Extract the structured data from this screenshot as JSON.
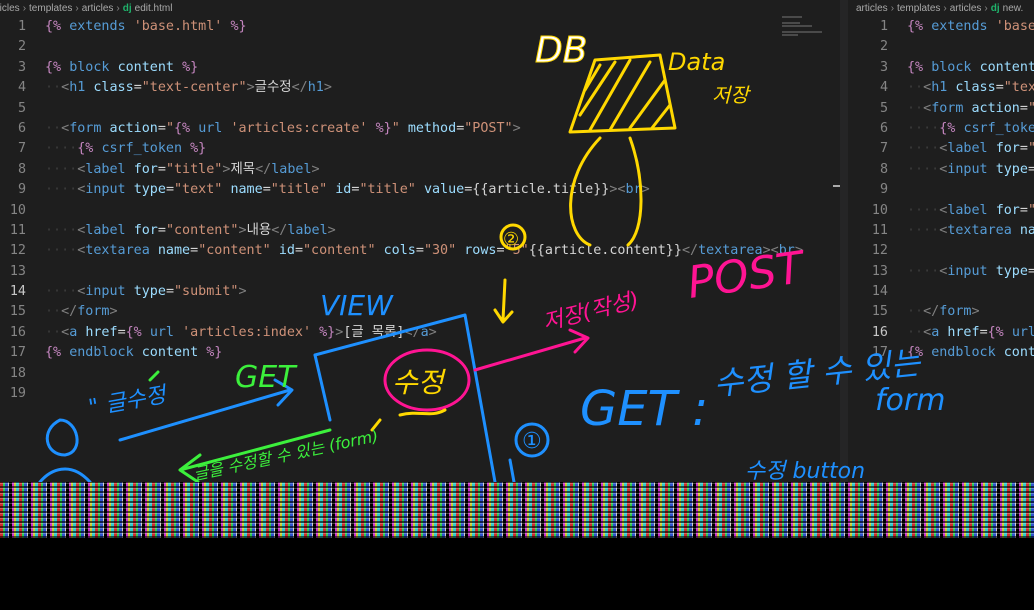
{
  "left_pane": {
    "breadcrumbs": [
      "articles",
      "templates",
      "articles"
    ],
    "file_badge": "dj",
    "file_name": "edit.html",
    "active_line": 14,
    "lines": [
      {
        "n": "1",
        "html": "<span class='tmpl'>{%</span> <span class='kw'>extends</span> <span class='str'>'base.html'</span> <span class='tmpl'>%}</span>"
      },
      {
        "n": "2",
        "html": ""
      },
      {
        "n": "3",
        "html": "<span class='tmpl'>{%</span> <span class='kw'>block</span> <span class='var'>content</span> <span class='tmpl'>%}</span>"
      },
      {
        "n": "4",
        "html": "<span class='ws'>··</span><span class='pun'>&lt;</span><span class='tag'>h1</span> <span class='attr'>class</span><span class='txt'>=</span><span class='str'>\"text-center\"</span><span class='pun'>&gt;</span><span class='txt'>글수정</span><span class='pun'>&lt;/</span><span class='tag'>h1</span><span class='pun'>&gt;</span>"
      },
      {
        "n": "5",
        "html": ""
      },
      {
        "n": "6",
        "html": "<span class='ws'>··</span><span class='pun'>&lt;</span><span class='tag'>form</span> <span class='attr'>action</span><span class='txt'>=</span><span class='str'>\"</span><span class='tmpl'>{%</span> <span class='kw'>url</span> <span class='str'>'articles:create'</span> <span class='tmpl'>%}</span><span class='str'>\"</span> <span class='attr'>method</span><span class='txt'>=</span><span class='str'>\"POST\"</span><span class='pun'>&gt;</span>"
      },
      {
        "n": "7",
        "html": "<span class='ws'>····</span><span class='tmpl'>{%</span> <span class='kw'>csrf_token</span> <span class='tmpl'>%}</span>"
      },
      {
        "n": "8",
        "html": "<span class='ws'>····</span><span class='pun'>&lt;</span><span class='tag'>label</span> <span class='attr'>for</span><span class='txt'>=</span><span class='str'>\"title\"</span><span class='pun'>&gt;</span><span class='txt'>제목</span><span class='pun'>&lt;/</span><span class='tag'>label</span><span class='pun'>&gt;</span>"
      },
      {
        "n": "9",
        "html": "<span class='ws'>····</span><span class='pun'>&lt;</span><span class='tag'>input</span> <span class='attr'>type</span><span class='txt'>=</span><span class='str'>\"text\"</span> <span class='attr'>name</span><span class='txt'>=</span><span class='str'>\"title\"</span> <span class='attr'>id</span><span class='txt'>=</span><span class='str'>\"title\"</span> <span class='attr'>value</span><span class='txt'>={{article.title}}</span><span class='pun'>&gt;&lt;</span><span class='tag'>br</span><span class='pun'>&gt;</span>"
      },
      {
        "n": "10",
        "html": ""
      },
      {
        "n": "11",
        "html": "<span class='ws'>····</span><span class='pun'>&lt;</span><span class='tag'>label</span> <span class='attr'>for</span><span class='txt'>=</span><span class='str'>\"content\"</span><span class='pun'>&gt;</span><span class='txt'>내용</span><span class='pun'>&lt;/</span><span class='tag'>label</span><span class='pun'>&gt;</span>"
      },
      {
        "n": "12",
        "html": "<span class='ws'>····</span><span class='pun'>&lt;</span><span class='tag'>textarea</span> <span class='attr'>name</span><span class='txt'>=</span><span class='str'>\"content\"</span> <span class='attr'>id</span><span class='txt'>=</span><span class='str'>\"content\"</span> <span class='attr'>cols</span><span class='txt'>=</span><span class='str'>\"30\"</span> <span class='attr'>rows</span><span class='txt'>=</span><span class='str'>\"5\"</span><span class='txt'>{{article.content}}</span><span class='pun'>&lt;/</span><span class='tag'>textarea</span><span class='pun'>&gt;&lt;</span><span class='tag'>br</span><span class='pun'>&gt;</span>"
      },
      {
        "n": "13",
        "html": ""
      },
      {
        "n": "14",
        "html": "<span class='ws'>····</span><span class='pun'>&lt;</span><span class='tag'>input</span> <span class='attr'>type</span><span class='txt'>=</span><span class='str'>\"submit\"</span><span class='pun'>&gt;</span>"
      },
      {
        "n": "15",
        "html": "<span class='ws'>··</span><span class='pun'>&lt;/</span><span class='tag'>form</span><span class='pun'>&gt;</span>"
      },
      {
        "n": "16",
        "html": "<span class='ws'>··</span><span class='pun'>&lt;</span><span class='tag'>a</span> <span class='attr'>href</span><span class='txt'>=</span><span class='tmpl'>{%</span> <span class='kw'>url</span> <span class='str'>'articles:index'</span> <span class='tmpl'>%}</span><span class='pun'>&gt;</span><span class='txt'>[글 목록]</span><span class='pun'>&lt;/</span><span class='tag'>a</span><span class='pun'>&gt;</span>"
      },
      {
        "n": "17",
        "html": "<span class='tmpl'>{%</span> <span class='kw'>endblock</span> <span class='var'>content</span> <span class='tmpl'>%}</span>"
      },
      {
        "n": "18",
        "html": ""
      },
      {
        "n": "19",
        "html": ""
      }
    ]
  },
  "right_pane": {
    "breadcrumbs": [
      "articles",
      "templates",
      "articles"
    ],
    "file_badge": "dj",
    "file_name": "new.",
    "active_line": 16,
    "lines": [
      {
        "n": "1",
        "html": "<span class='tmpl'>{%</span> <span class='kw'>extends</span> <span class='str'>'base.</span>"
      },
      {
        "n": "2",
        "html": ""
      },
      {
        "n": "3",
        "html": "<span class='tmpl'>{%</span> <span class='kw'>block</span> <span class='var'>content</span>"
      },
      {
        "n": "4",
        "html": "<span class='ws'>··</span><span class='pun'>&lt;</span><span class='tag'>h1</span> <span class='attr'>class</span><span class='txt'>=</span><span class='str'>\"text</span>"
      },
      {
        "n": "5",
        "html": "<span class='ws'>··</span><span class='pun'>&lt;</span><span class='tag'>form</span> <span class='attr'>action</span><span class='txt'>=</span><span class='str'>\"{</span>"
      },
      {
        "n": "6",
        "html": "<span class='ws'>····</span><span class='tmpl'>{%</span> <span class='kw'>csrf_token</span>"
      },
      {
        "n": "7",
        "html": "<span class='ws'>····</span><span class='pun'>&lt;</span><span class='tag'>label</span> <span class='attr'>for</span><span class='txt'>=</span><span class='str'>\"t</span>"
      },
      {
        "n": "8",
        "html": "<span class='ws'>····</span><span class='pun'>&lt;</span><span class='tag'>input</span> <span class='attr'>type</span><span class='txt'>=</span><span class='str'>\"</span>"
      },
      {
        "n": "9",
        "html": ""
      },
      {
        "n": "10",
        "html": "<span class='ws'>····</span><span class='pun'>&lt;</span><span class='tag'>label</span> <span class='attr'>for</span><span class='txt'>=</span><span class='str'>\"c</span>"
      },
      {
        "n": "11",
        "html": "<span class='ws'>····</span><span class='pun'>&lt;</span><span class='tag'>textarea</span> <span class='attr'>nam</span>"
      },
      {
        "n": "12",
        "html": ""
      },
      {
        "n": "13",
        "html": "<span class='ws'>····</span><span class='pun'>&lt;</span><span class='tag'>input</span> <span class='attr'>type</span><span class='txt'>=</span><span class='str'>\"</span>"
      },
      {
        "n": "14",
        "html": ""
      },
      {
        "n": "15",
        "html": "<span class='ws'>··</span><span class='pun'>&lt;/</span><span class='tag'>form</span><span class='pun'>&gt;</span>"
      },
      {
        "n": "16",
        "html": "<span class='ws'>··</span><span class='pun'>&lt;</span><span class='tag'>a</span> <span class='attr'>href</span><span class='txt'>=</span><span class='tmpl'>{%</span> <span class='kw'>url</span> <span class='str'>'</span>"
      },
      {
        "n": "17",
        "html": "<span class='tmpl'>{%</span> <span class='kw'>endblock</span> <span class='var'>conte</span>"
      }
    ]
  },
  "annotations": {
    "db": "DB",
    "data": "Data",
    "data_sub": "저장",
    "view": "VIEW",
    "get_left": "GET",
    "post": "POST",
    "save": "저장(작성)",
    "receive": "수정",
    "quote_edit": "\" 글수정",
    "form_hint": "글을 수정할 수 있는 (form)",
    "circle_one": "①",
    "circle_two": "②",
    "get_right": "GET :",
    "get_right_desc": "수정 할 수 있는",
    "form_word": "form",
    "bottom_scribble": "수정  button",
    "colors": {
      "cyan": "#1e90ff",
      "green": "#3cf03c",
      "magenta": "#ff1493",
      "yellow": "#ffd800",
      "white": "#e6f0ff"
    }
  }
}
